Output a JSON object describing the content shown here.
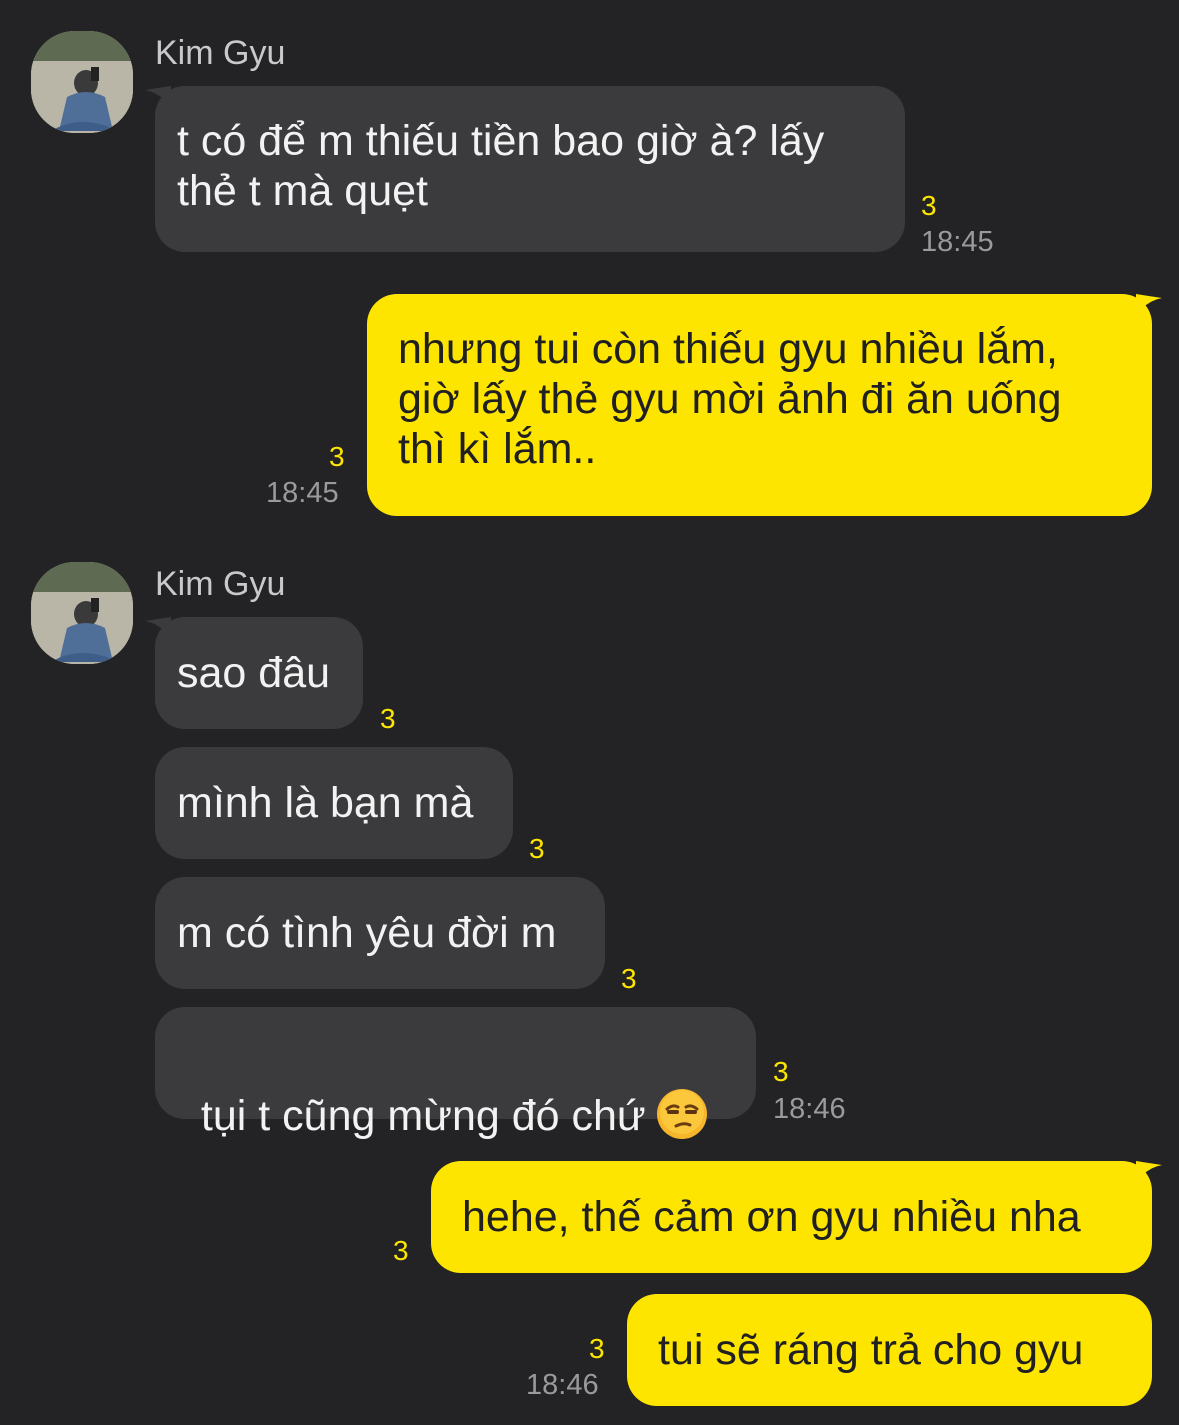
{
  "messages": [
    {
      "sender": "Kim Gyu",
      "text": "t có để m thiếu tiền bao giờ à? lấy\nthẻ t mà quẹt",
      "count": "3",
      "time": "18:45"
    },
    {
      "text": "nhưng tui còn thiếu gyu nhiều lắm,\ngiờ lấy thẻ gyu mời ảnh đi ăn uống\nthì kì lắm..",
      "count": "3",
      "time": "18:45"
    },
    {
      "sender": "Kim Gyu",
      "text": "sao đâu",
      "count": "3"
    },
    {
      "text": "mình là bạn mà",
      "count": "3"
    },
    {
      "text": "m có tình yêu đời m",
      "count": "3"
    },
    {
      "text": "tụi t cũng mừng đó chứ",
      "emoji": "unamused-face-emoji",
      "count": "3",
      "time": "18:46"
    },
    {
      "text": "hehe, thế cảm ơn gyu nhiều nha",
      "count": "3"
    },
    {
      "text": "tui sẽ ráng trả cho gyu",
      "count": "3",
      "time": "18:46"
    }
  ],
  "colors": {
    "background": "#232325",
    "incoming": "#3b3b3e",
    "outgoing": "#fee500",
    "count": "#fee500",
    "time": "#9a9a9e"
  }
}
